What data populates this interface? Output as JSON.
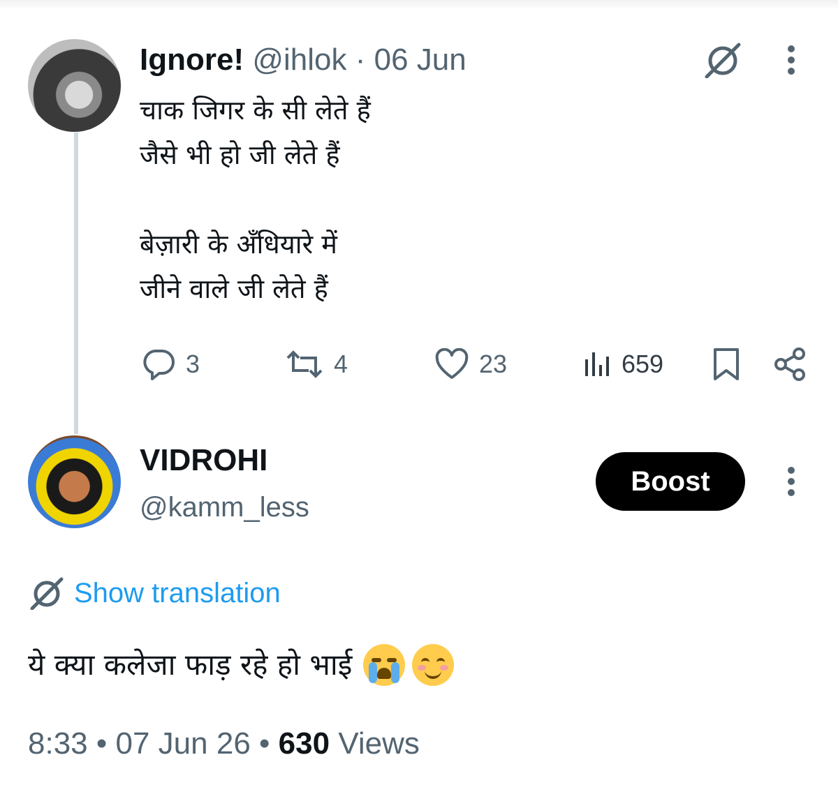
{
  "original_tweet": {
    "display_name": "Ignore!",
    "handle": "@ihlok",
    "separator": "·",
    "date": "06 Jun",
    "text": "चाक जिगर के सी लेते हैं\nजैसे भी हो जी लेते हैं\n\nबेज़ारी के अँधियारे में\nजीने वाले जी लेते हैं",
    "actions": {
      "replies": "3",
      "retweets": "4",
      "likes": "23",
      "views": "659"
    },
    "icons": [
      "translate-icon",
      "more-icon",
      "reply-icon",
      "retweet-icon",
      "like-icon",
      "views-icon",
      "bookmark-icon",
      "share-icon"
    ]
  },
  "reply": {
    "display_name": "VIDROHI",
    "handle": "@kamm_less",
    "boost_label": "Boost",
    "show_translation": "Show translation",
    "text": "ये क्या कलेजा फाड़ रहे हो भाई",
    "emojis": [
      "loudly-crying-face",
      "smiling-face-with-smiling-eyes"
    ],
    "time": "8:33",
    "dot": "•",
    "date": "07 Jun 26",
    "views_count": "630",
    "views_label": "Views"
  },
  "colors": {
    "muted": "#536471",
    "link": "#1d9bf0",
    "thread_line": "#cfd9de",
    "button_bg": "#000000"
  }
}
